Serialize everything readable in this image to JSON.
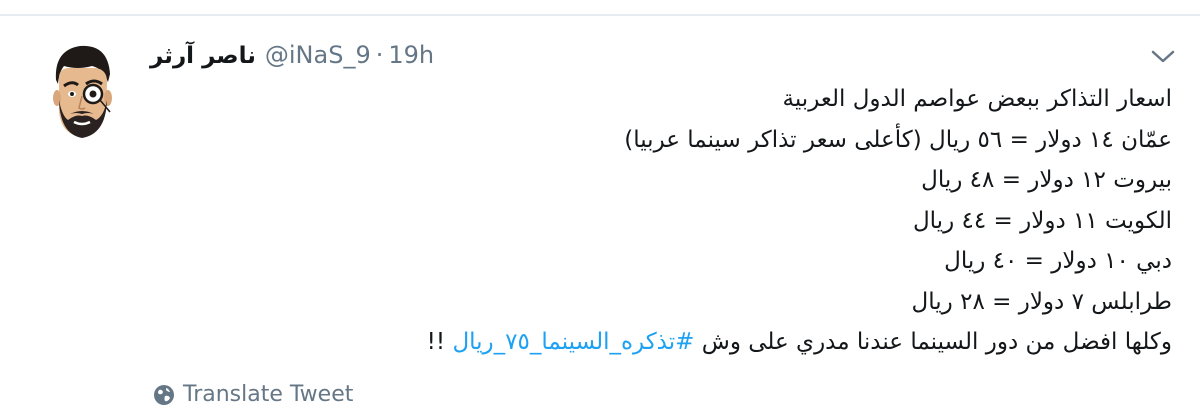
{
  "tweet": {
    "author": {
      "display_name": "ناصر آرثر",
      "handle": "@iNaS_9",
      "avatar_icon": "cartoon-man-with-monocle-avatar"
    },
    "separator": "·",
    "time": "19h",
    "menu_icon": "chevron-down-icon",
    "body": {
      "lines": [
        "اسعار التذاكر ببعض عواصم الدول العربية",
        "عمّان ١٤ دولار = ٥٦ ريال (كأعلى سعر تذاكر سينما عربيا)",
        "بيروت ١٢ دولار = ٤٨ ريال",
        "الكويت ١١ دولار = ٤٤ ريال",
        "دبي ١٠ دولار = ٤٠ ريال",
        "طرابلس ٧ دولار = ٢٨ ريال"
      ],
      "last_line_before": "وكلها افضل من دور السينما عندنا مدري على وش ",
      "hashtag": "#تذكره_السينما_٧٥_ريال",
      "last_line_after": " !!"
    },
    "translate": {
      "label": "Translate Tweet",
      "icon": "globe-icon"
    }
  },
  "colors": {
    "link": "#1da1f2",
    "secondary_text": "#657786",
    "primary_text": "#14171a",
    "divider": "#e6ecf0"
  }
}
